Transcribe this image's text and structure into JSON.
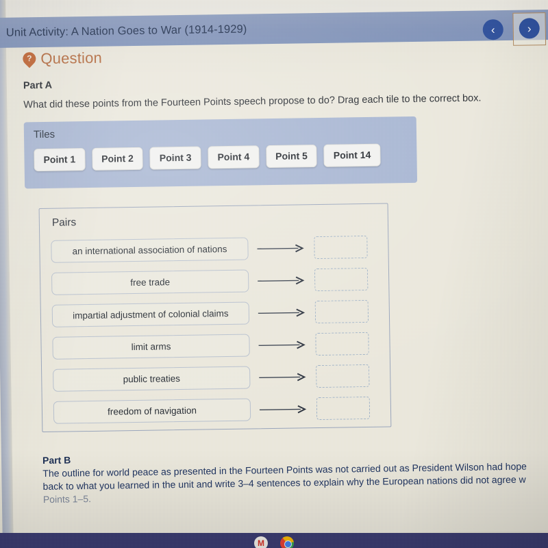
{
  "header": {
    "title": "Unit Activity: A Nation Goes to War (1914-1929)",
    "prev_icon": "‹",
    "next_icon": "›",
    "prev_label": "Previous",
    "next_label": "Next"
  },
  "question": {
    "pin_glyph": "?",
    "label": "Question"
  },
  "part_a": {
    "title": "Part A",
    "prompt": "What did these points from the Fourteen Points speech propose to do? Drag each tile to the correct box."
  },
  "tiles": {
    "label": "Tiles",
    "items": [
      "Point 1",
      "Point 2",
      "Point 3",
      "Point 4",
      "Point 5",
      "Point 14"
    ]
  },
  "pairs": {
    "label": "Pairs",
    "rows": [
      {
        "text": "an international association of nations",
        "answer": ""
      },
      {
        "text": "free trade",
        "answer": ""
      },
      {
        "text": "impartial adjustment of colonial claims",
        "answer": ""
      },
      {
        "text": "limit arms",
        "answer": ""
      },
      {
        "text": "public treaties",
        "answer": ""
      },
      {
        "text": "freedom of navigation",
        "answer": ""
      }
    ]
  },
  "part_b": {
    "title": "Part B",
    "line1": "The outline for world peace as presented in the Fourteen Points was not carried out as President Wilson had hope",
    "line2": "back to what you learned in the unit and write 3–4 sentences to explain why the European nations did not agree w",
    "line3": "Points 1–5."
  },
  "taskbar": {
    "gmail_glyph": "M",
    "gmail_label": "Gmail",
    "chrome_label": "Chrome"
  },
  "colors": {
    "header_bar": "#8496bd",
    "tiles_panel": "#a7b6d4",
    "question_accent": "#b5683a",
    "nav_button": "#2c4f9e",
    "page_bg": "#edeade",
    "drop_box_border": "#9fb3c9",
    "taskbar": "#3b3c72"
  }
}
